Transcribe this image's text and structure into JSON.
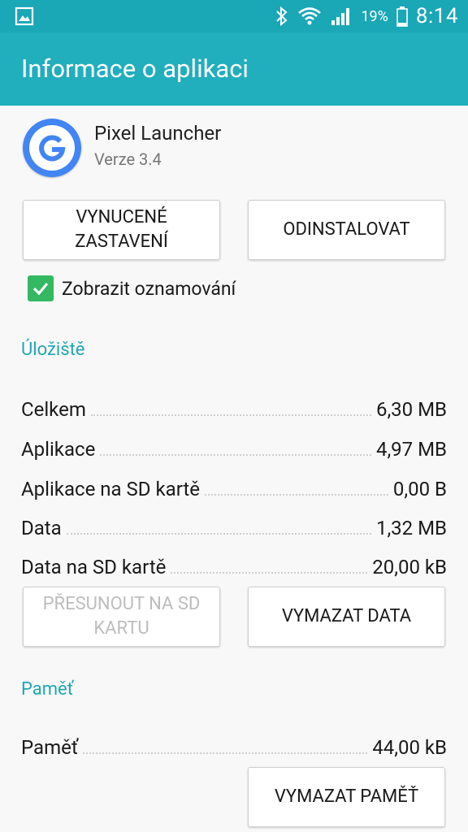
{
  "status_bar": {
    "left_icon": "image-notification-icon",
    "icons": [
      "bluetooth-icon",
      "wifi-icon",
      "signal-icon"
    ],
    "battery_percent": "19%",
    "time": "8:14"
  },
  "app_bar": {
    "title": "Informace o aplikaci"
  },
  "app": {
    "name": "Pixel Launcher",
    "version": "Verze 3.4",
    "icon": "google-g-icon"
  },
  "actions": {
    "force_stop_label": "VYNUCENÉ ZASTAVENÍ",
    "uninstall_label": "ODINSTALOVAT"
  },
  "notifications": {
    "label": "Zobrazit oznamování",
    "checked": true
  },
  "storage": {
    "header": "Úložiště",
    "rows": [
      {
        "label": "Celkem",
        "value": "6,30 MB"
      },
      {
        "label": "Aplikace",
        "value": "4,97 MB"
      },
      {
        "label": "Aplikace na SD kartě",
        "value": "0,00 B"
      },
      {
        "label": "Data",
        "value": "1,32 MB"
      },
      {
        "label": "Data na SD kartě",
        "value": "20,00 kB"
      }
    ],
    "move_label": "PŘESUNOUT NA SD KARTU",
    "clear_data_label": "VYMAZAT DATA"
  },
  "cache": {
    "header": "Paměť",
    "row": {
      "label": "Paměť",
      "value": "44,00 kB"
    },
    "clear_cache_label": "VYMAZAT PAMĚŤ"
  },
  "colors": {
    "status_bar": "#1aa7b6",
    "app_bar": "#21aebd",
    "accent": "#22a6b4",
    "checkbox": "#34b862"
  }
}
